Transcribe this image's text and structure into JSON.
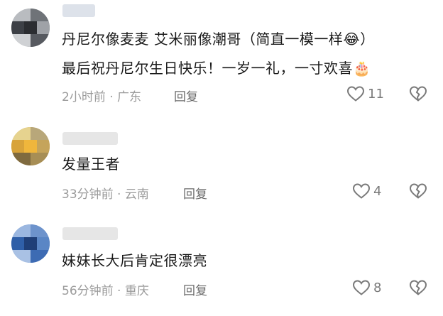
{
  "comments": [
    {
      "lines": [
        "丹尼尔像麦麦 艾米丽像潮哥（简直一模一样",
        "最后祝丹尼尔生日快乐！一岁一礼，一寸欢喜"
      ],
      "emoji1": "😂",
      "emoji2": "🎂",
      "time": "2小时前",
      "location": "广东",
      "reply": "回复",
      "likes": "11"
    },
    {
      "lines": [
        "发量王者"
      ],
      "time": "33分钟前",
      "location": "云南",
      "reply": "回复",
      "likes": "4"
    },
    {
      "lines": [
        "妹妹长大后肯定很漂亮"
      ],
      "time": "56分钟前",
      "location": "重庆",
      "reply": "回复",
      "likes": "8"
    }
  ],
  "separator": "·",
  "icons": {
    "like": "heart-outline-icon",
    "dislike": "broken-heart-icon"
  },
  "colors": {
    "text": "#1a1a1a",
    "meta": "#9b9b9b",
    "icon": "#7a7a7a"
  }
}
